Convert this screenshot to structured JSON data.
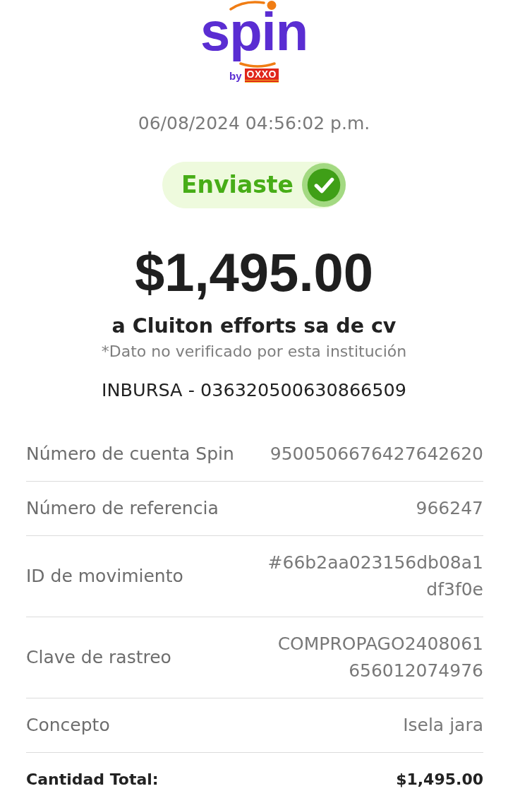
{
  "logo": {
    "wordmark": "spin",
    "byline": "by",
    "partner": "OXXO"
  },
  "timestamp": "06/08/2024 04:56:02 p.m.",
  "status": {
    "label": "Enviaste"
  },
  "amount": "$1,495.00",
  "recipient": "a Cluiton efforts sa de cv",
  "disclaimer": "*Dato no verificado por esta institución",
  "destination": "INBURSA - 036320500630866509",
  "details": [
    {
      "kind": "row",
      "label": "Número de cuenta Spin",
      "value": "9500506676427642620"
    },
    {
      "kind": "row",
      "label": "Número de referencia",
      "value": "966247"
    },
    {
      "kind": "row",
      "label": "ID de movimiento",
      "value": "#66b2aa023156db08a1df3f0e"
    },
    {
      "kind": "row",
      "label": "Clave de rastreo",
      "value": "COMPROPAGO2408061656012074976"
    },
    {
      "kind": "row",
      "label": "Concepto",
      "value": "Isela jara"
    },
    {
      "kind": "total",
      "label": "Cantidad Total:",
      "value": "$1,495.00"
    }
  ]
}
